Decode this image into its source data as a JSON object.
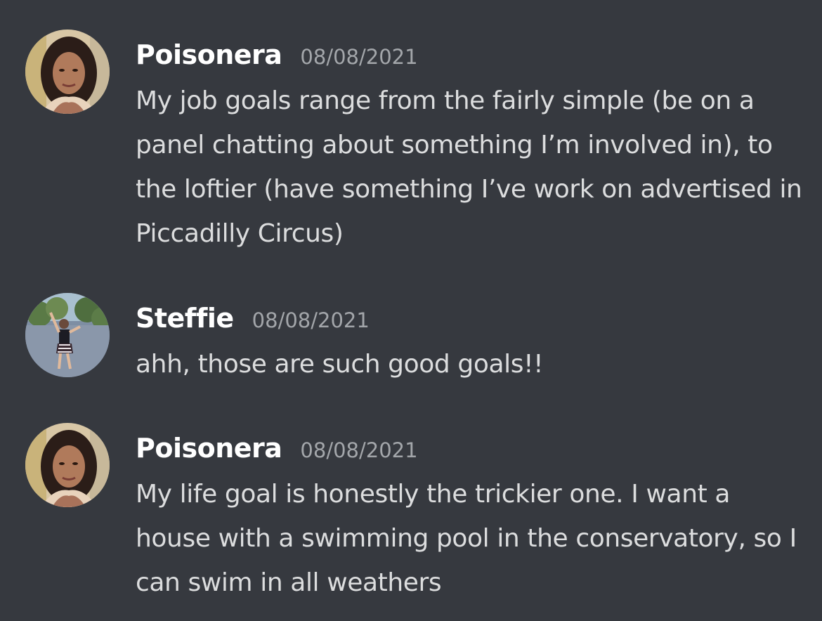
{
  "messages": [
    {
      "author": "Poisonera",
      "timestamp": "08/08/2021",
      "avatar": "poisonera-avatar-photo",
      "text": "My job goals range from the fairly simple (be on a panel chatting about something I’m involved in), to the loftier (have something I’ve work on advertised in Piccadilly Circus)"
    },
    {
      "author": "Steffie",
      "timestamp": "08/08/2021",
      "avatar": "steffie-avatar-photo",
      "text": "ahh, those are such good goals!!"
    },
    {
      "author": "Poisonera",
      "timestamp": "08/08/2021",
      "avatar": "poisonera-avatar-photo",
      "text": "My life goal is honestly the trickier one. I want a house with a swimming pool in the conservatory, so I can swim in all weathers"
    }
  ],
  "colors": {
    "background": "#36393f",
    "username": "#ffffff",
    "timestamp": "#a3a6aa",
    "message_text": "#dcddde"
  }
}
